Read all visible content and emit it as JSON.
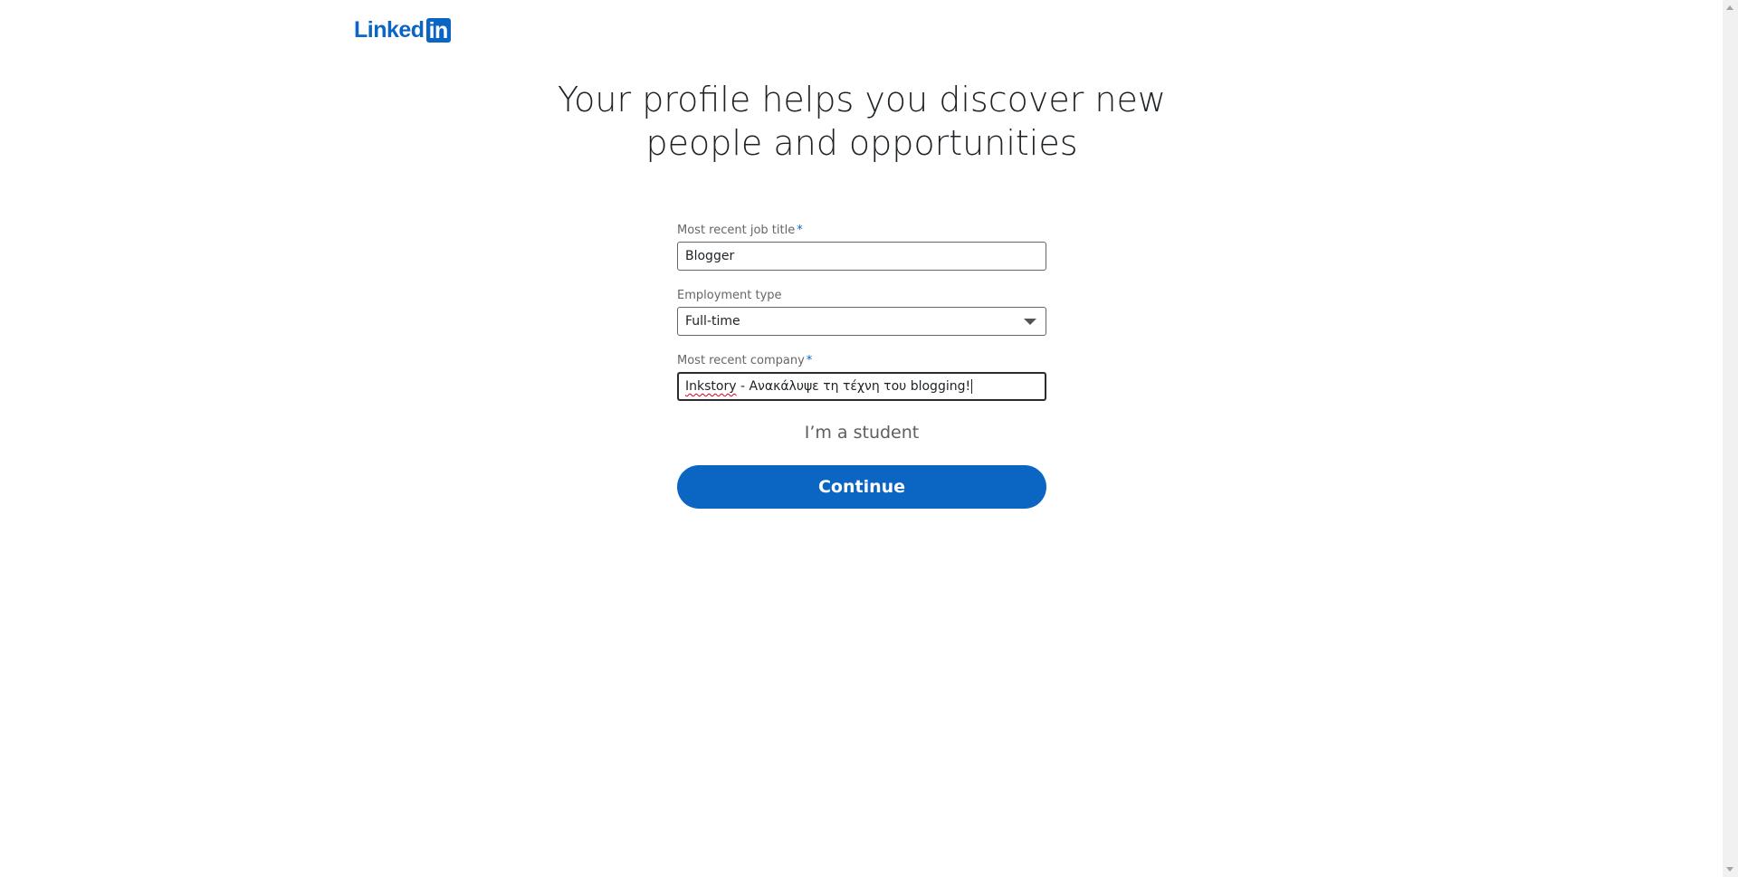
{
  "logo": {
    "text_left": "Linked",
    "text_box": "in"
  },
  "headline": {
    "line1": "Your profile helps you discover new",
    "line2": "people and opportunities"
  },
  "form": {
    "job_title": {
      "label": "Most recent job title",
      "required_marker": "*",
      "value": "Blogger"
    },
    "employment_type": {
      "label": "Employment type",
      "selected": "Full-time"
    },
    "company": {
      "label": "Most recent company",
      "required_marker": "*",
      "value_misspelled": "Inkstory",
      "value_rest": " - Ανακάλυψε τη τέχνη του blogging!"
    },
    "student_link": "I’m a student",
    "continue_label": "Continue"
  },
  "colors": {
    "brand": "#0a66c2",
    "heading": "#1d2226",
    "muted_label": "#666666"
  },
  "icons": {
    "dropdown": "chevron-down-icon",
    "scroll_up": "scroll-up-arrow-icon",
    "scroll_down": "scroll-down-arrow-icon"
  }
}
